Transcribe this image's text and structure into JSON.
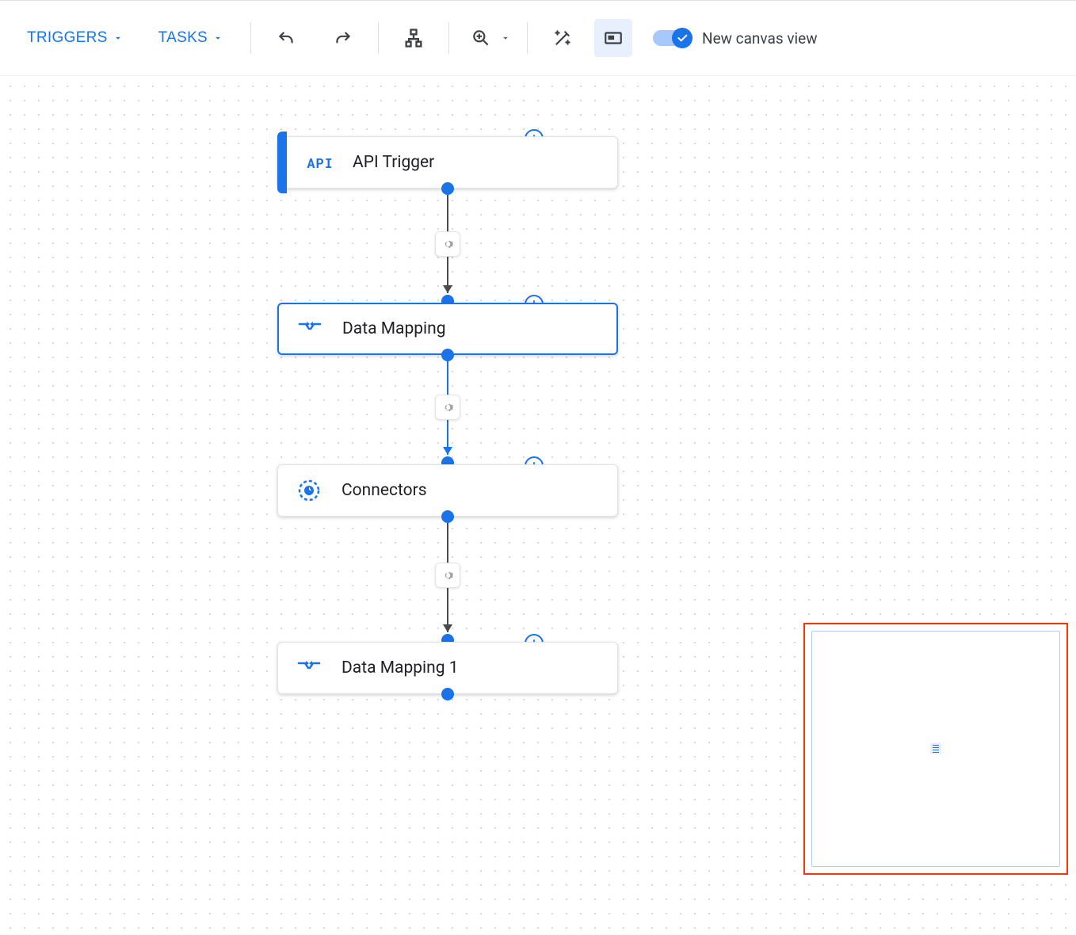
{
  "toolbar": {
    "triggers_label": "TRIGGERS",
    "tasks_label": "TASKS",
    "toggle_label": "New canvas view"
  },
  "nodes": {
    "api_trigger": {
      "label": "API Trigger",
      "icon_text": "API"
    },
    "data_mapping": {
      "label": "Data Mapping"
    },
    "connectors": {
      "label": "Connectors"
    },
    "data_mapping_1": {
      "label": "Data Mapping 1"
    }
  }
}
